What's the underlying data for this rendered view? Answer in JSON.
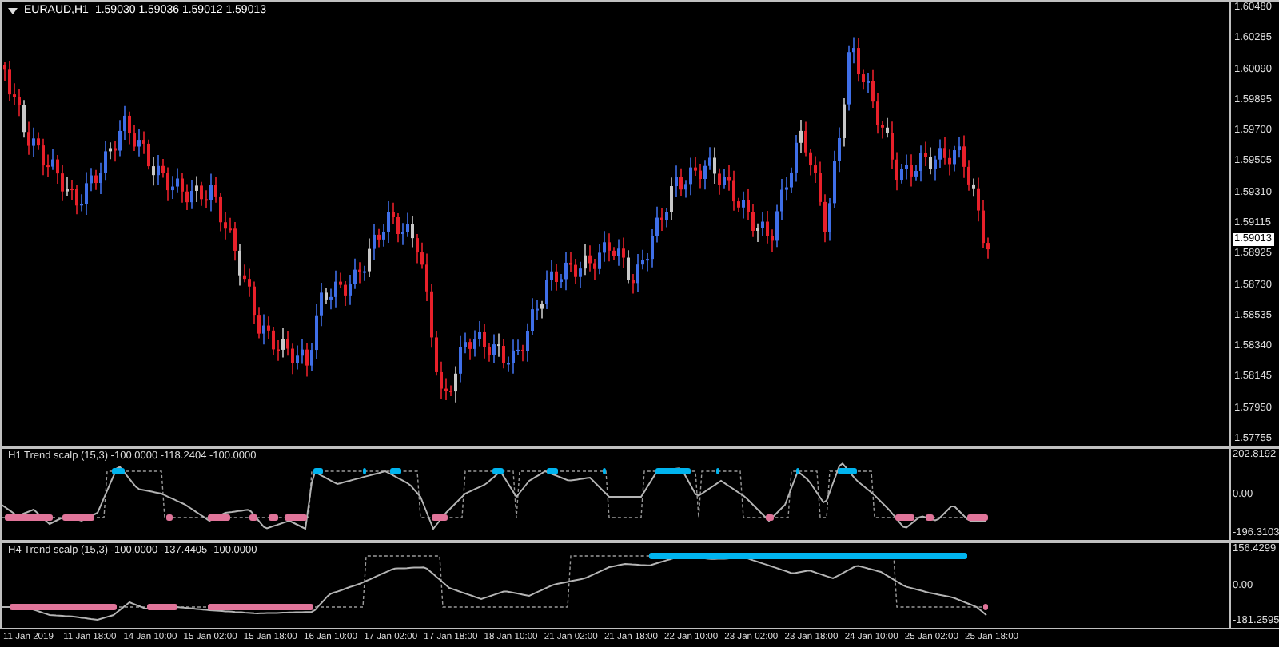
{
  "main_chart": {
    "symbol": "EURAUD,H1",
    "ohlc": "1.59030 1.59036 1.59012 1.59013",
    "price_axis": [
      "1.60480",
      "1.60285",
      "1.60090",
      "1.59895",
      "1.59700",
      "1.59505",
      "1.59310",
      "1.59115",
      "1.58925",
      "1.58730",
      "1.58535",
      "1.58340",
      "1.58145",
      "1.57950",
      "1.57755"
    ],
    "current_price": "1.59013"
  },
  "indicators": [
    {
      "title": "H1 Trend scalp (15,3) -100.0000 -118.2404 -100.0000",
      "axis": [
        "202.8192",
        "0.00",
        "-196.3103"
      ]
    },
    {
      "title": "H4 Trend scalp (15,3) -100.0000 -137.4405 -100.0000",
      "axis": [
        "156.4299",
        "0.00",
        "-181.2595"
      ]
    }
  ],
  "time_axis": [
    "11 Jan 2019",
    "11 Jan 18:00",
    "14 Jan 10:00",
    "15 Jan 02:00",
    "15 Jan 18:00",
    "16 Jan 10:00",
    "17 Jan 02:00",
    "17 Jan 18:00",
    "18 Jan 10:00",
    "21 Jan 02:00",
    "21 Jan 18:00",
    "22 Jan 10:00",
    "23 Jan 02:00",
    "23 Jan 18:00",
    "24 Jan 10:00",
    "25 Jan 02:00",
    "25 Jan 18:00"
  ]
}
